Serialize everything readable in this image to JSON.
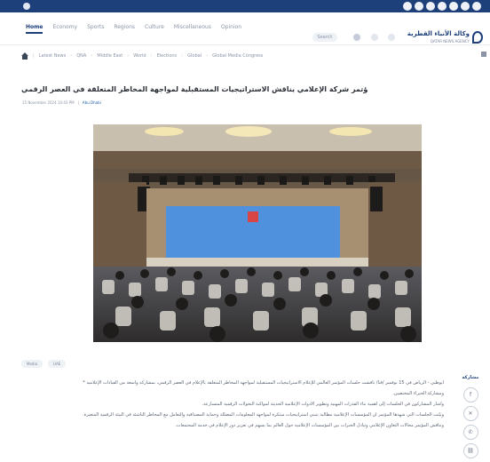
{
  "topbar": {
    "text": "",
    "social": [
      "facebook-icon",
      "x-icon",
      "instagram-icon",
      "youtube-icon",
      "telegram-icon",
      "linkedin-icon",
      "rss-icon"
    ]
  },
  "nav": {
    "items": [
      "Home",
      "Economy",
      "Sports",
      "Regions",
      "Culture",
      "Miscellaneous",
      "Opinion"
    ],
    "search_label": "Search"
  },
  "logo": {
    "name": "وكالة الأنباء القطرية",
    "subtitle": "QATAR NEWS AGENCY"
  },
  "breadcrumb": [
    "Latest News",
    "QNA",
    "Middle East",
    "World",
    "Elections",
    "Global",
    "Global Media Congress"
  ],
  "article": {
    "title": "مؤتمر شركة الإعلامي يناقش الاستراتيجيات المستقبلية لمواجهة المخاطر المتعلقة في العصر الرقمي",
    "date": "15 November 2024 10:43 PM",
    "author": "Abu Dhabi",
    "tags": [
      "Media",
      "UAE"
    ],
    "paragraphs": [
      "أبوظبي - الرياض في 15 نوفمبر /قنا/ ناقشت جلسات المؤتمر العالمي للإعلام الاستراتيجيات المستقبلية لمواجهة المخاطر المتعلقة بالإعلام في العصر الرقمي، بمشاركة واسعة من القيادات الإعلامية *",
      "ومشاركة الخبراء المختصين.",
      "وأشار المشاركون في الجلسات إلى أهمية بناء القدرات المهنية وتطوير الأدوات الإعلامية الحديثة لمواكبة التحولات الرقمية المتسارعة.",
      "وبيّنت الجلسات التي شهدها المؤتمر أن المؤسسات الإعلامية مطالبة بتبني استراتيجيات مبتكرة لمواجهة المعلومات المضللة وحماية المصداقية والتعامل مع المخاطر الناشئة في البيئة الرقمية المتغيرة.",
      "وتناقش المؤتمر مجالات التعاون الإعلامي وتبادل الخبرات بين المؤسسات الإعلامية حول العالم بما يسهم في تعزيز دور الإعلام في خدمة المجتمعات."
    ]
  },
  "share": {
    "label": "مشاركة",
    "icons": [
      "facebook-icon",
      "x-icon",
      "whatsapp-icon",
      "link-icon"
    ]
  },
  "colors": {
    "brand": "#1d3f7a",
    "stage_screen": "#3f86d8",
    "hall_background": "#4a3b2e"
  }
}
